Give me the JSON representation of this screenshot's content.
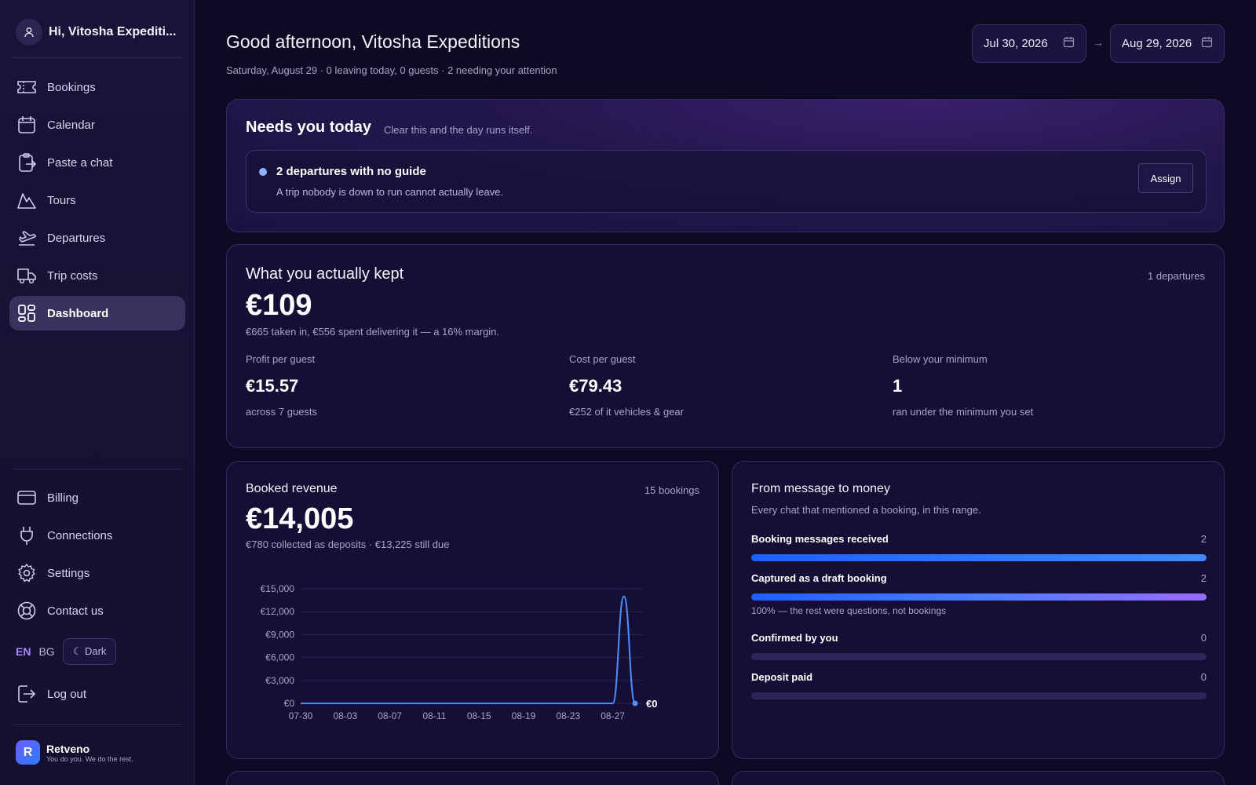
{
  "sidebar": {
    "user_greeting": "Hi, Vitosha Expediti...",
    "nav_main": [
      {
        "label": "Bookings",
        "icon": "ticket-icon"
      },
      {
        "label": "Calendar",
        "icon": "calendar-icon"
      },
      {
        "label": "Paste a chat",
        "icon": "clipboard-icon"
      },
      {
        "label": "Tours",
        "icon": "mountain-icon"
      },
      {
        "label": "Departures",
        "icon": "plane-departure-icon"
      },
      {
        "label": "Trip costs",
        "icon": "truck-icon"
      },
      {
        "label": "Dashboard",
        "icon": "dashboard-icon",
        "active": true
      }
    ],
    "nav_secondary": [
      {
        "label": "Billing",
        "icon": "credit-card-icon"
      },
      {
        "label": "Connections",
        "icon": "plug-icon"
      },
      {
        "label": "Settings",
        "icon": "gear-icon"
      },
      {
        "label": "Contact us",
        "icon": "lifebuoy-icon"
      }
    ],
    "lang_en": "EN",
    "lang_bg": "BG",
    "theme_label": "☾ Dark",
    "logout_label": "Log out",
    "brand_name": "Retveno",
    "brand_tagline": "You do you. We do the rest."
  },
  "header": {
    "greeting": "Good afternoon, Vitosha Expeditions",
    "subline": "Saturday, August 29 · 0 leaving today, 0 guests · 2 needing your attention",
    "date_from": "Jul 30, 2026",
    "date_to": "Aug 29, 2026",
    "arrow": "→"
  },
  "needs": {
    "title": "Needs you today",
    "subtitle": "Clear this and the day runs itself.",
    "item_title": "2 departures with no guide",
    "item_desc": "A trip nobody is down to run cannot actually leave.",
    "action": "Assign"
  },
  "kept": {
    "title": "What you actually kept",
    "departures": "1 departures",
    "amount": "€109",
    "note": "€665 taken in, €556 spent delivering it — a 16% margin.",
    "stats": [
      {
        "label": "Profit per guest",
        "value": "€15.57",
        "note": "across 7 guests"
      },
      {
        "label": "Cost per guest",
        "value": "€79.43",
        "note": "€252 of it vehicles & gear"
      },
      {
        "label": "Below your minimum",
        "value": "1",
        "note": "ran under the minimum you set"
      }
    ]
  },
  "revenue": {
    "title": "Booked revenue",
    "count": "15 bookings",
    "amount": "€14,005",
    "note": "€780 collected as deposits · €13,225 still due",
    "end_label": "€0"
  },
  "chart_data": {
    "type": "line",
    "title": "",
    "xlabel": "",
    "ylabel": "",
    "ylim": [
      0,
      15000
    ],
    "y_ticks": [
      "€15,000",
      "€12,000",
      "€9,000",
      "€6,000",
      "€3,000",
      "€0"
    ],
    "x_ticks": [
      "07-30",
      "08-03",
      "08-07",
      "08-11",
      "08-15",
      "08-19",
      "08-23",
      "08-27"
    ],
    "grid": true,
    "series": [
      {
        "x": [
          "07-30",
          "07-31",
          "08-01",
          "08-02",
          "08-03",
          "08-04",
          "08-05",
          "08-06",
          "08-07",
          "08-08",
          "08-09",
          "08-10",
          "08-11",
          "08-12",
          "08-13",
          "08-14",
          "08-15",
          "08-16",
          "08-17",
          "08-18",
          "08-19",
          "08-20",
          "08-21",
          "08-22",
          "08-23",
          "08-24",
          "08-25",
          "08-26",
          "08-27",
          "08-28",
          "08-29"
        ],
        "values": [
          0,
          0,
          0,
          0,
          0,
          0,
          0,
          0,
          0,
          0,
          0,
          0,
          0,
          0,
          0,
          0,
          0,
          0,
          0,
          0,
          0,
          0,
          0,
          0,
          0,
          0,
          0,
          0,
          0,
          14005,
          0
        ],
        "color": "#4d8dff"
      }
    ]
  },
  "funnel": {
    "title": "From message to money",
    "subtitle": "Every chat that mentioned a booking, in this range.",
    "rows": [
      {
        "label": "Booking messages received",
        "value": "2",
        "fill": 1.0
      },
      {
        "label": "Captured as a draft booking",
        "value": "2",
        "fill": 1.0
      },
      {
        "label": "Confirmed by you",
        "value": "0",
        "fill": 0
      },
      {
        "label": "Deposit paid",
        "value": "0",
        "fill": 0
      }
    ],
    "note": "100% — the rest were questions, not bookings"
  },
  "colors": {
    "accent": "#a88bff",
    "bar_blue": "#2f6bff",
    "bar_purple": "#9a6bff"
  }
}
